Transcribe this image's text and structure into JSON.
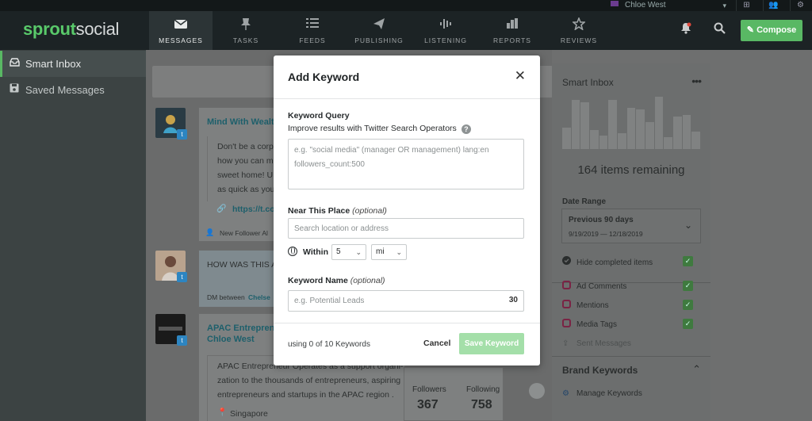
{
  "account": {
    "user_name": "Chloe West"
  },
  "nav": {
    "logo_strong": "sprout",
    "logo_light": "social",
    "items": [
      {
        "label": "MESSAGES",
        "icon": "inbox-icon"
      },
      {
        "label": "TASKS",
        "icon": "pin-icon"
      },
      {
        "label": "FEEDS",
        "icon": "list-icon"
      },
      {
        "label": "PUBLISHING",
        "icon": "paper-plane-icon"
      },
      {
        "label": "LISTENING",
        "icon": "waveform-icon"
      },
      {
        "label": "REPORTS",
        "icon": "bar-chart-icon"
      },
      {
        "label": "REVIEWS",
        "icon": "star-icon"
      }
    ],
    "compose_label": "Compose"
  },
  "sidebar": {
    "items": [
      {
        "label": "Smart Inbox",
        "active": true
      },
      {
        "label": "Saved Messages",
        "active": false
      }
    ]
  },
  "feed": {
    "card1": {
      "title": "Mind With Wealt",
      "text_lines": [
        "Don't be a corp",
        "how you can m",
        "sweet home! U",
        "as quick as you"
      ],
      "link": "https://t.co",
      "meta": "New Follower Al"
    },
    "card2": {
      "title": "HOW WAS THIS A",
      "meta_prefix": "DM between",
      "meta_name": "Chelse"
    },
    "card3": {
      "title_line1": "APAC Entreprene",
      "title_line2": "Chloe West",
      "text_lines": [
        "APAC Entrepreneur Operates as a support organi-",
        "zation to the thousands of entrepreneurs, aspiring",
        "entrepreneurs and startups in the APAC region ."
      ],
      "location": "Singapore",
      "followers_label": "Followers",
      "followers_value": "367",
      "following_label": "Following",
      "following_value": "758"
    }
  },
  "smart_inbox": {
    "title": "Smart Inbox",
    "menu": "•••",
    "bars": [
      0.38,
      0.88,
      0.85,
      0.35,
      0.25,
      0.88,
      0.28,
      0.75,
      0.72,
      0.48,
      0.95,
      0.22,
      0.58,
      0.62,
      0.32
    ],
    "remaining": "164 items remaining",
    "date_range_label": "Date Range",
    "date_range_value": "Previous 90 days",
    "date_range_dates": "9/19/2019 — 12/18/2019",
    "hide_completed": "Hide completed items",
    "filters": [
      "Ad Comments",
      "Mentions",
      "Media Tags"
    ],
    "sent_messages": "Sent Messages",
    "brand_keywords": "Brand Keywords",
    "manage_keywords": "Manage Keywords"
  },
  "modal": {
    "title": "Add Keyword",
    "query_label": "Keyword Query",
    "query_help": "Improve results with Twitter Search Operators",
    "query_placeholder": "e.g. \"social media\" (manager OR management) lang:en followers_count:500",
    "place_label": "Near This Place",
    "place_optional": "(optional)",
    "place_placeholder": "Search location or address",
    "within_label": "Within",
    "within_value": "5",
    "unit_value": "mi",
    "name_label": "Keyword Name",
    "name_optional": "(optional)",
    "name_placeholder": "e.g. Potential Leads",
    "name_counter": "30",
    "usage": "using 0 of 10 Keywords",
    "cancel_label": "Cancel",
    "save_label": "Save Keyword"
  },
  "colors": {
    "brand_green": "#59b864",
    "save_disabled": "#a4dfa9",
    "link_teal": "#1d5f6b"
  }
}
